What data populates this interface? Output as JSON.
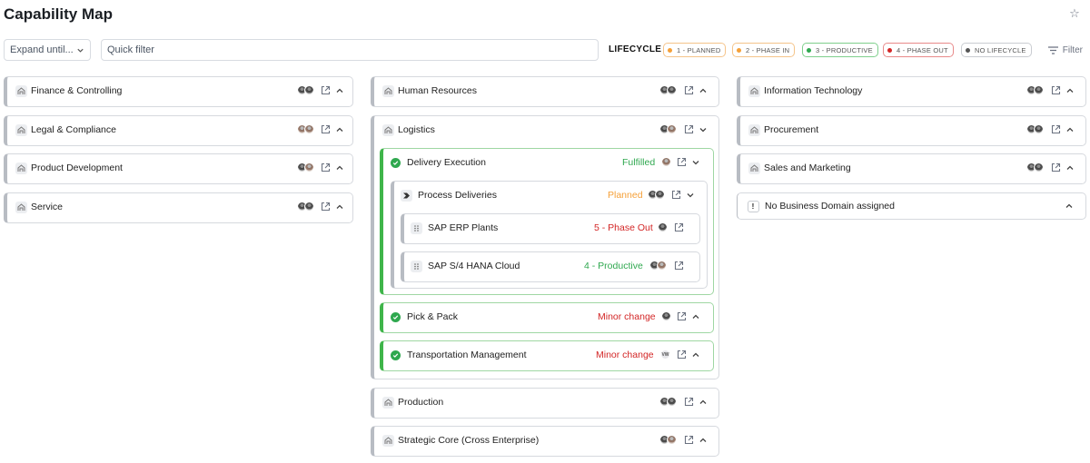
{
  "header": {
    "title": "Capability Map"
  },
  "toolbar": {
    "expand_label": "Expand until...",
    "quick_filter_placeholder": "Quick filter",
    "lifecycle_label": "LIFECYCLE",
    "chips": [
      {
        "label": "1 - PLANNED",
        "color": "#f5a038"
      },
      {
        "label": "2 - PHASE IN",
        "color": "#f5a038"
      },
      {
        "label": "3 - PRODUCTIVE",
        "color": "#2fa84f"
      },
      {
        "label": "4 - PHASE OUT",
        "color": "#d32626"
      },
      {
        "label": "NO LIFECYCLE",
        "color": "#555555"
      }
    ],
    "filter_label": "Filter"
  },
  "columns": {
    "left": [
      {
        "label": "Finance & Controlling"
      },
      {
        "label": "Legal & Compliance"
      },
      {
        "label": "Product Development"
      },
      {
        "label": "Service"
      }
    ],
    "middle": {
      "human_resources": "Human Resources",
      "logistics": {
        "label": "Logistics",
        "delivery_execution": {
          "label": "Delivery Execution",
          "status": "Fulfilled",
          "process_deliveries": {
            "label": "Process Deliveries",
            "status": "Planned",
            "apps": [
              {
                "label": "SAP ERP Plants",
                "status": "5 - Phase Out"
              },
              {
                "label": "SAP S/4 HANA Cloud",
                "status": "4 - Productive"
              }
            ]
          }
        },
        "pick_pack": {
          "label": "Pick & Pack",
          "status": "Minor change"
        },
        "transport": {
          "label": "Transportation Management",
          "status": "Minor change",
          "avatar_initials": "VW"
        }
      },
      "production": "Production",
      "strategic_core": "Strategic Core (Cross Enterprise)"
    },
    "right": [
      {
        "label": "Information Technology"
      },
      {
        "label": "Procurement"
      },
      {
        "label": "Sales and Marketing"
      },
      {
        "label": "No Business Domain assigned"
      }
    ]
  }
}
